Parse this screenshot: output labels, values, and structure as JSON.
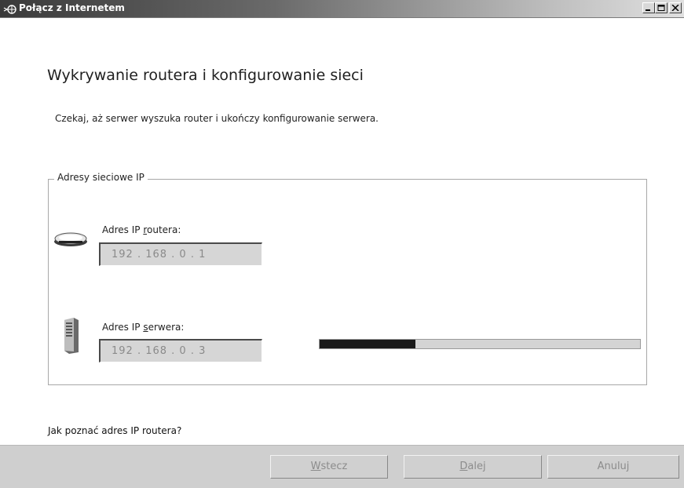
{
  "window": {
    "title": "Połącz z Internetem",
    "controls": [
      "minimize-icon",
      "maximize-icon",
      "close-icon"
    ]
  },
  "main": {
    "heading": "Wykrywanie routera i konfigurowanie sieci",
    "description": "Czekaj, aż serwer wyszuka router i ukończy konfigurowanie serwera."
  },
  "group": {
    "legend": "Adresy sieciowe IP",
    "router": {
      "icon": "router-icon",
      "label_pre": "Adres IP ",
      "label_accel": "r",
      "label_post": "outera:",
      "ip": "192  .  168  .    0   .    1"
    },
    "server": {
      "icon": "server-icon",
      "label_pre": "Adres IP ",
      "label_accel": "s",
      "label_post": "erwera:",
      "ip": "192  .  168  .    0   .    3"
    },
    "progress": 0.3
  },
  "help_link": "Jak poznać adres IP routera?",
  "buttons": {
    "back_accel": "W",
    "back_rest": "stecz",
    "next_accel": "D",
    "next_rest": "alej",
    "cancel": "Anuluj"
  }
}
